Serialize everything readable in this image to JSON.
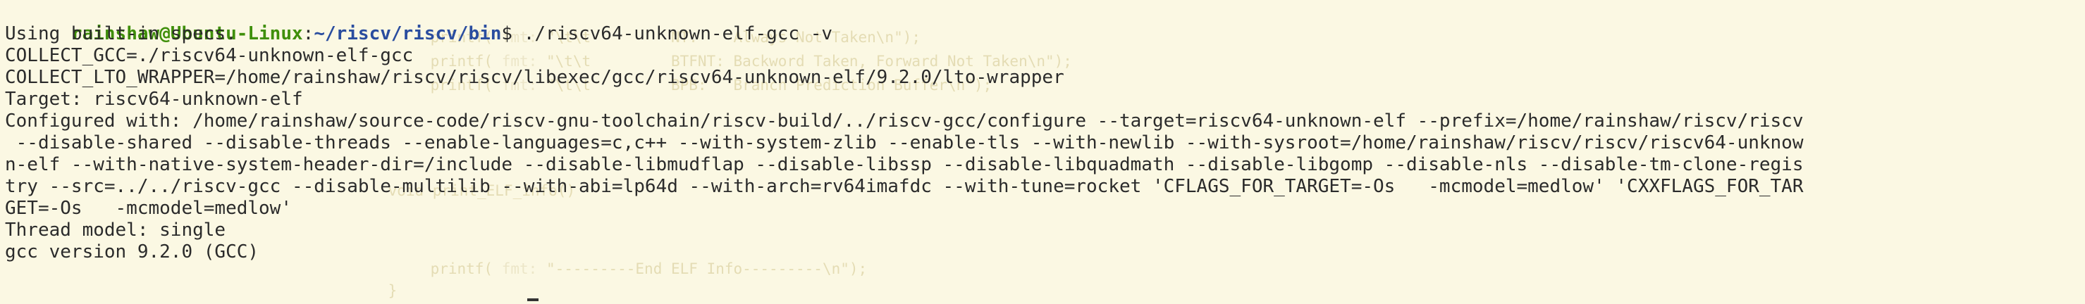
{
  "prompt": {
    "user_host": "rainshaw@Ubuntu-Linux",
    "separator": ":",
    "path": "~/riscv/riscv/bin",
    "symbol": "$ ",
    "command": "./riscv64-unknown-elf-gcc -v"
  },
  "output": [
    "Using built-in specs.",
    "COLLECT_GCC=./riscv64-unknown-elf-gcc",
    "COLLECT_LTO_WRAPPER=/home/rainshaw/riscv/riscv/libexec/gcc/riscv64-unknown-elf/9.2.0/lto-wrapper",
    "Target: riscv64-unknown-elf",
    "Configured with: /home/rainshaw/source-code/riscv-gnu-toolchain/riscv-build/../riscv-gcc/configure --target=riscv64-unknown-elf --prefix=/home/rainshaw/riscv/riscv",
    " --disable-shared --disable-threads --enable-languages=c,c++ --with-system-zlib --enable-tls --with-newlib --with-sysroot=/home/rainshaw/riscv/riscv/riscv64-unknow",
    "n-elf --with-native-system-header-dir=/include --disable-libmudflap --disable-libssp --disable-libquadmath --disable-libgomp --disable-nls --disable-tm-clone-regis",
    "try --src=../../riscv-gcc --disable-multilib --with-abi=lp64d --with-arch=rv64imafdc --with-tune=rocket 'CFLAGS_FOR_TARGET=-Os   -mcmodel=medlow' 'CXXFLAGS_FOR_TAR",
    "GET=-Os   -mcmodel=medlow'",
    "Thread model: single",
    "gcc version 9.2.0 (GCC)"
  ],
  "background_code": {
    "line1": {
      "fn": "printf(",
      "fmt": "fmt:",
      "str": "\"\\t\\t         NT:    Always Not Taken\\n\");"
    },
    "line2": {
      "fn": "printf(",
      "fmt": "fmt:",
      "str": "\"\\t\\t         BTFNT: Backword Taken, Forward Not Taken\\n\");"
    },
    "line3": {
      "fn": "printf(",
      "fmt": "fmt:",
      "str": "\"\\t\\t         BPB:   Branch Prediction Buffer\\n\");"
    },
    "line4": {
      "fn": "printf(",
      "fmt": "fmt:",
      "str": "\"---------End ELF Info---------\\n\");"
    },
    "line5": {
      "text": "}"
    },
    "line6": {
      "text": "void print_ELF_info()"
    }
  }
}
